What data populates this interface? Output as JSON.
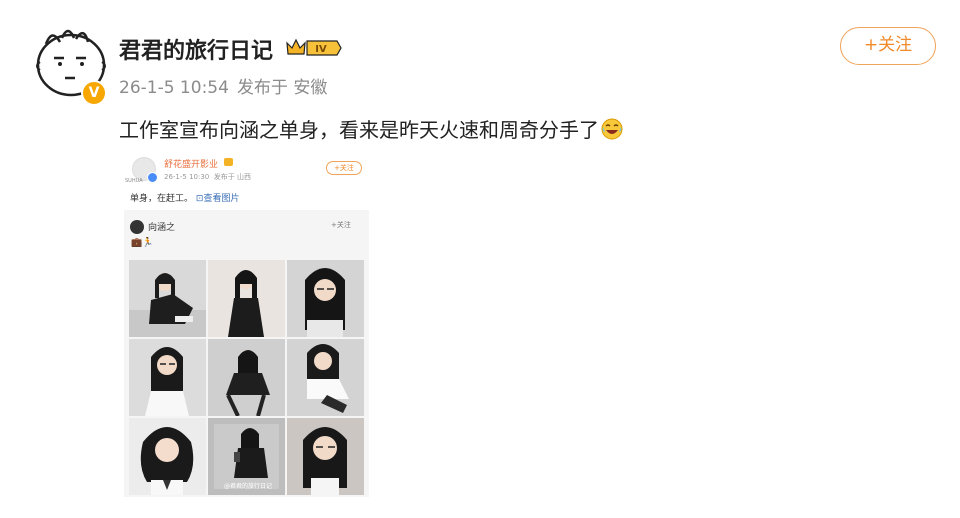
{
  "post": {
    "username": "君君的旅行日记",
    "level_badge": "IV",
    "v_badge": "V",
    "timestamp": "26-1-5 10:54",
    "source": "发布于 安徽",
    "follow_label": "+关注",
    "text": "工作室宣布向涵之单身，看来是昨天火速和周奇分手了",
    "accent_color": "#f08a2a"
  },
  "embedded": {
    "username": "舒花盛开影业",
    "logo_text": "SUHUA",
    "timestamp": "26-1-5 10:30",
    "source": "发布于 山西",
    "follow_label": "+关注",
    "text": "单身，在赶工。",
    "link_label": "查看图片",
    "card": {
      "username": "向涵之",
      "follow_label": "+关注",
      "emoji_line": "💼🏃",
      "watermark": "@君君的旅行日记"
    },
    "photos": [
      {
        "name": "photo-1",
        "desc": "woman-sitting-black-outfit"
      },
      {
        "name": "photo-2",
        "desc": "woman-black-dress"
      },
      {
        "name": "photo-3",
        "desc": "woman-glasses-portrait"
      },
      {
        "name": "photo-4",
        "desc": "woman-glasses-white-top"
      },
      {
        "name": "photo-5",
        "desc": "woman-sitting-chair"
      },
      {
        "name": "photo-6",
        "desc": "woman-white-shirt-sitting"
      },
      {
        "name": "photo-7",
        "desc": "woman-curly-hair-portrait"
      },
      {
        "name": "photo-8",
        "desc": "woman-phone-mirror-selfie"
      },
      {
        "name": "photo-9",
        "desc": "woman-glasses-closeup"
      }
    ]
  }
}
